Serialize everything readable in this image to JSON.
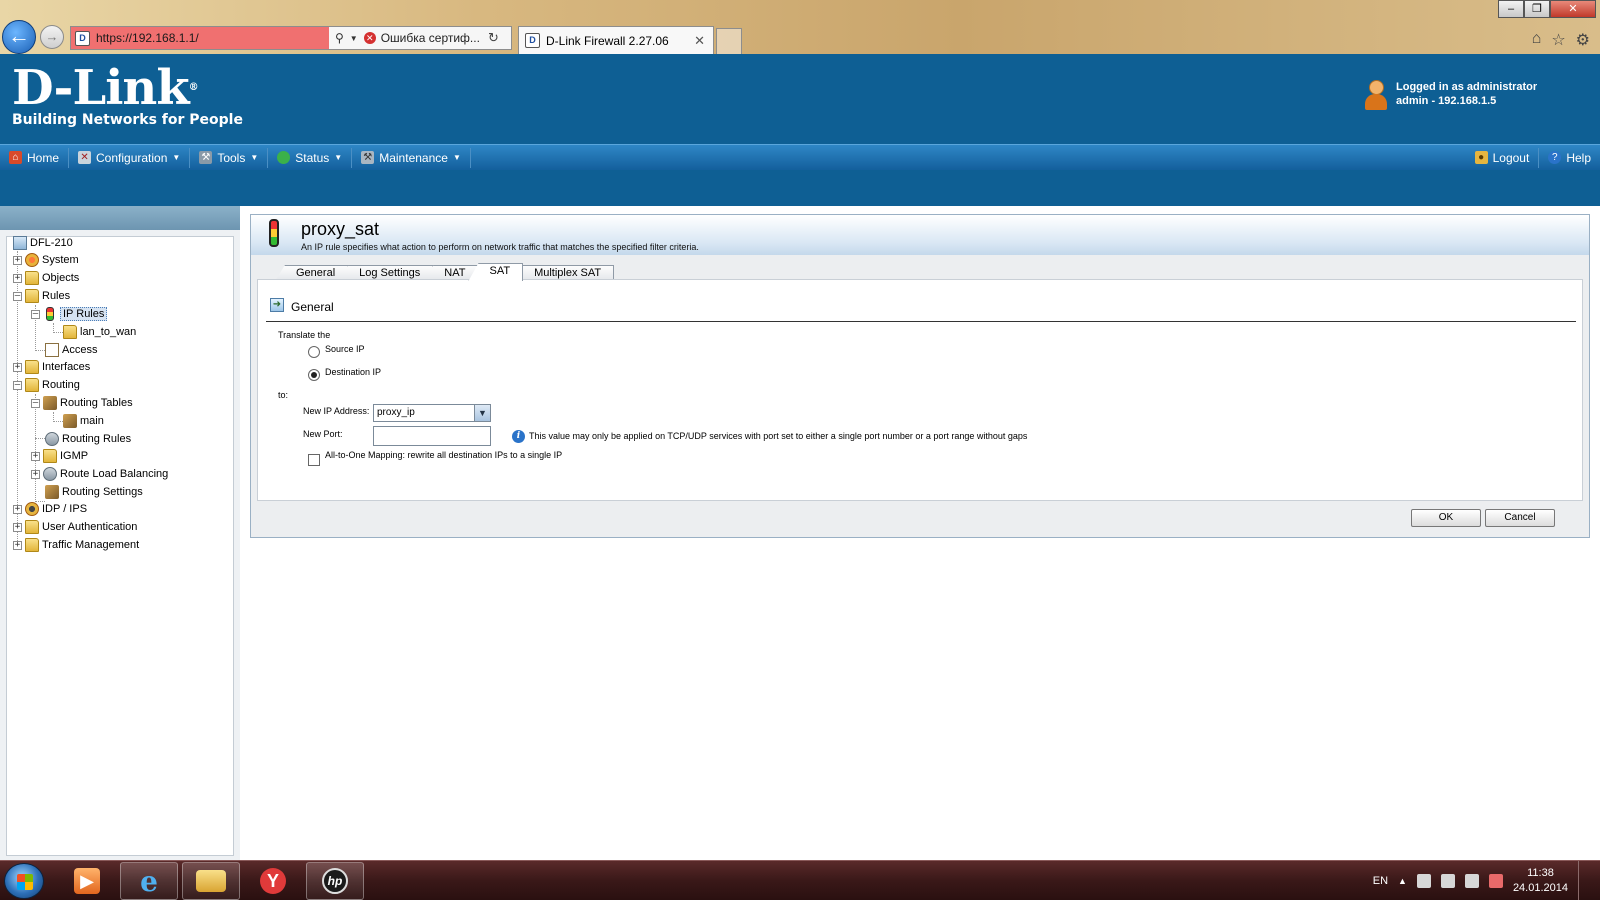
{
  "browser": {
    "url": "https://192.168.1.1/",
    "cert_error": "Ошибка сертиф...",
    "tab_title": "D-Link Firewall 2.27.06"
  },
  "header": {
    "logo": "D-Link",
    "tagline": "Building Networks for People",
    "login_line1": "Logged in as administrator",
    "login_line2": "admin - 192.168.1.5"
  },
  "menu": {
    "home": "Home",
    "configuration": "Configuration",
    "tools": "Tools",
    "status": "Status",
    "maintenance": "Maintenance",
    "logout": "Logout",
    "help": "Help"
  },
  "tree": {
    "root": "DFL-210",
    "system": "System",
    "objects": "Objects",
    "rules": "Rules",
    "ip_rules": "IP Rules",
    "lan_to_wan": "lan_to_wan",
    "access": "Access",
    "interfaces": "Interfaces",
    "routing": "Routing",
    "routing_tables": "Routing Tables",
    "main": "main",
    "routing_rules": "Routing Rules",
    "igmp": "IGMP",
    "route_load_balancing": "Route Load Balancing",
    "routing_settings": "Routing Settings",
    "idp_ips": "IDP / IPS",
    "user_authentication": "User Authentication",
    "traffic_management": "Traffic Management"
  },
  "page": {
    "title": "proxy_sat",
    "subtitle": "An IP rule specifies what action to perform on network traffic that matches the specified filter criteria.",
    "tabs": [
      "General",
      "Log Settings",
      "NAT",
      "SAT",
      "Multiplex SAT"
    ],
    "section_title": "General",
    "translate_label": "Translate the",
    "source_ip": "Source IP",
    "destination_ip": "Destination IP",
    "to_label": "to:",
    "new_ip_label": "New IP Address:",
    "new_ip_value": "proxy_ip",
    "new_port_label": "New Port:",
    "new_port_value": "",
    "port_info": "This value may only be applied on TCP/UDP services with port set to either a single port number or a port range without gaps",
    "all_to_one": "All-to-One Mapping: rewrite all destination IPs to a single IP",
    "ok": "OK",
    "cancel": "Cancel"
  },
  "taskbar": {
    "lang": "EN",
    "time": "11:38",
    "date": "24.01.2014"
  }
}
